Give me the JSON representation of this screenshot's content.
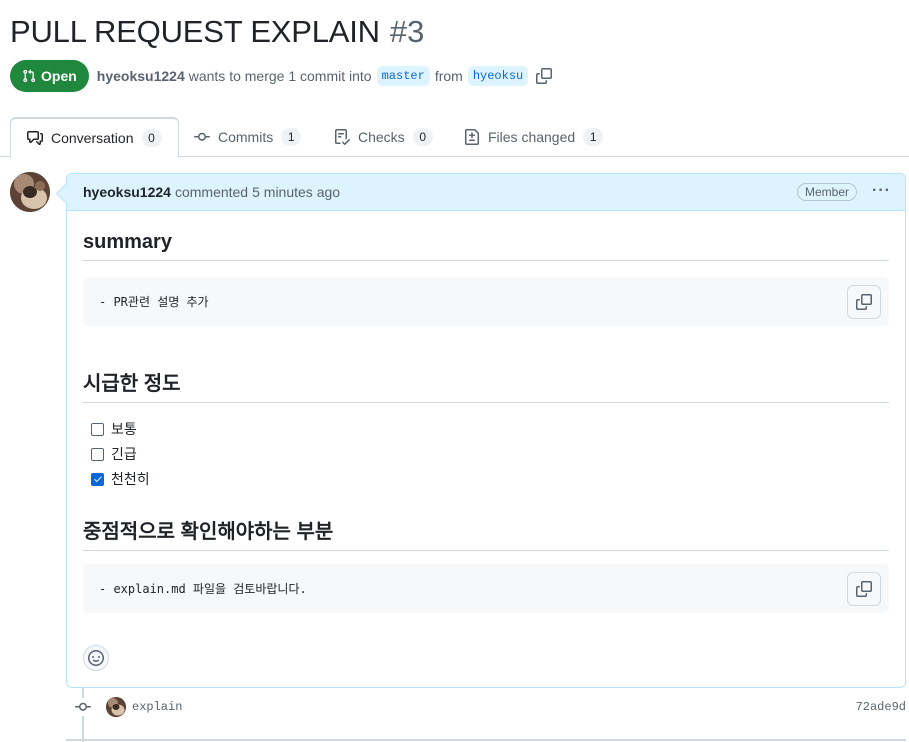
{
  "pr": {
    "title": "PULL REQUEST EXPLAIN",
    "number": "#3",
    "state": "Open",
    "author": "hyeoksu1224",
    "merge_text": "wants to merge 1 commit into",
    "base_branch": "master",
    "from_text": "from",
    "head_branch": "hyeoksu"
  },
  "tabs": [
    {
      "label": "Conversation",
      "count": "0",
      "icon": "comment-discussion-icon"
    },
    {
      "label": "Commits",
      "count": "1",
      "icon": "git-commit-icon"
    },
    {
      "label": "Checks",
      "count": "0",
      "icon": "checklist-icon"
    },
    {
      "label": "Files changed",
      "count": "1",
      "icon": "file-diff-icon"
    }
  ],
  "comment": {
    "author": "hyeoksu1224",
    "action": "commented",
    "time": "5 minutes ago",
    "role": "Member",
    "menu": "···",
    "sections": {
      "summary_heading": "summary",
      "summary_code": "- PR관련 설명 추가",
      "urgency_heading": "시급한 정도",
      "tasks": [
        {
          "label": "보통",
          "checked": false
        },
        {
          "label": "긴급",
          "checked": false
        },
        {
          "label": "천천히",
          "checked": true
        }
      ],
      "focus_heading": "중점적으로 확인해야하는 부분",
      "focus_code": "- explain.md 파일을 검토바랍니다."
    }
  },
  "commit": {
    "message": "explain",
    "sha": "72ade9d"
  },
  "colors": {
    "open_green": "#1f883d",
    "branch_blue": "#0969da",
    "header_bg": "#ddf4ff"
  }
}
